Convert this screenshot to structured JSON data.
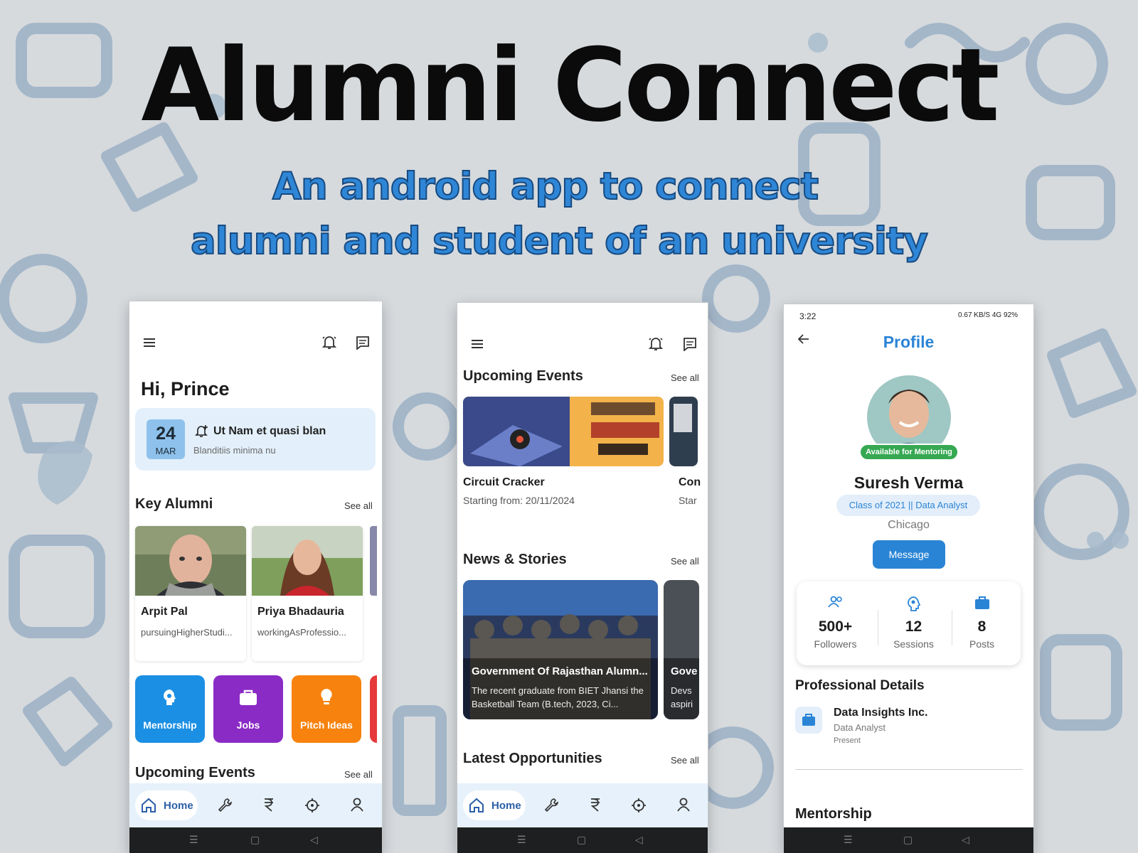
{
  "banner": {
    "title": "Alumni Connect",
    "subtitle_line1": "An android app to connect",
    "subtitle_line2": "alumni and student of an university"
  },
  "screen_home": {
    "greeting": "Hi, Prince",
    "event": {
      "day": "24",
      "month": "MAR",
      "title": "Ut Nam et quasi blan",
      "subtitle": "Blanditiis minima nu"
    },
    "key_alumni": {
      "heading": "Key Alumni",
      "see_all": "See all",
      "cards": [
        {
          "name": "Arpit Pal",
          "status": "pursuingHigherStudi..."
        },
        {
          "name": "Priya Bhadauria",
          "status": "workingAsProfessio..."
        }
      ]
    },
    "tiles": [
      {
        "label": "Mentorship",
        "color": "#1b8fe3",
        "icon": "mentorship-icon"
      },
      {
        "label": "Jobs",
        "color": "#8a2bc6",
        "icon": "briefcase-icon"
      },
      {
        "label": "Pitch Ideas",
        "color": "#f7820d",
        "icon": "lightbulb-icon"
      }
    ],
    "upcoming_heading": "Upcoming Events",
    "upcoming_see_all": "See all"
  },
  "screen_feed": {
    "upcoming": {
      "heading": "Upcoming Events",
      "see_all": "See all",
      "events": [
        {
          "name": "Circuit Cracker",
          "date": "Starting from: 20/11/2024"
        },
        {
          "name": "Con",
          "date": "Star"
        }
      ]
    },
    "news": {
      "heading": "News & Stories",
      "see_all": "See all",
      "items": [
        {
          "title": "Government Of Rajasthan Alumn...",
          "desc": "The recent graduate from BIET Jhansi the Basketball Team (B.tech, 2023, Ci..."
        },
        {
          "title": "Gove",
          "desc": "Devs aspiri"
        }
      ]
    },
    "opportunities_heading": "Latest Opportunities",
    "opportunities_see_all": "See all"
  },
  "nav": {
    "home_label": "Home",
    "icons": [
      "home-icon",
      "wrench-icon",
      "rupee-icon",
      "settings-icon",
      "person-icon"
    ]
  },
  "screen_profile": {
    "status_time": "3:22",
    "status_right": "0.67 KB/S 4G 92%",
    "title": "Profile",
    "mentoring_badge": "Available for Mentoring",
    "name": "Suresh Verma",
    "class_info": "Class of 2021 || Data Analyst",
    "city": "Chicago",
    "message_button": "Message",
    "stats": [
      {
        "value": "500+",
        "label": "Followers",
        "icon": "people-icon"
      },
      {
        "value": "12",
        "label": "Sessions",
        "icon": "mentor-head-icon"
      },
      {
        "value": "8",
        "label": "Posts",
        "icon": "briefcase-icon"
      }
    ],
    "professional_heading": "Professional Details",
    "job": {
      "company": "Data Insights Inc.",
      "role": "Data Analyst",
      "period": "Present"
    },
    "mentorship_heading": "Mentorship"
  },
  "colors": {
    "accent": "#2a84d6",
    "nav_bg": "#e6f1fb",
    "badge_green": "#36a852"
  }
}
